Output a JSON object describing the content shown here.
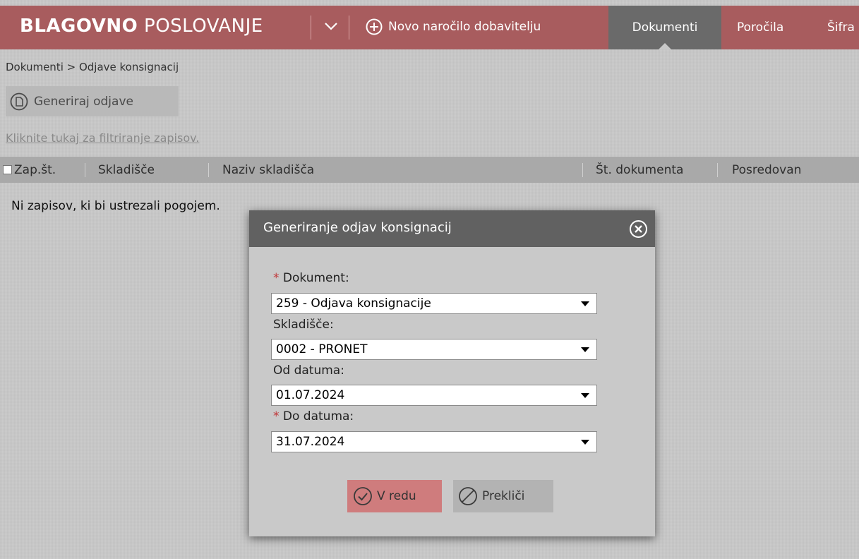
{
  "header": {
    "brand_bold": "BLAGOVNO",
    "brand_light": "POSLOVANJE",
    "new_order_label": "Novo naročilo dobavitelju",
    "nav": [
      "Dokumenti",
      "Poročila",
      "Šifra"
    ],
    "active_nav": "Dokumenti",
    "colors": {
      "bar": "#a85c5e",
      "active": "#6a6a6a"
    }
  },
  "breadcrumb": "Dokumenti > Odjave konsignacij",
  "toolbar": {
    "generate_label": "Generiraj odjave"
  },
  "filter_link": "Kliknite tukaj za filtriranje zapisov.",
  "table": {
    "columns": [
      "Zap.št.",
      "Skladišče",
      "Naziv skladišča",
      "Št. dokumenta",
      "Posredovan"
    ],
    "empty_message": "Ni zapisov, ki bi ustrezali pogojem."
  },
  "dialog": {
    "title": "Generiranje odjav konsignacij",
    "fields": [
      {
        "label": "Dokument:",
        "required": true,
        "value": "259 - Odjava konsignacije"
      },
      {
        "label": "Skladišče:",
        "required": false,
        "value": "0002 - PRONET"
      },
      {
        "label": "Od datuma:",
        "required": false,
        "value": "01.07.2024"
      },
      {
        "label": "Do datuma:",
        "required": true,
        "value": "31.07.2024"
      }
    ],
    "required_mark": "*",
    "ok_label": "V redu",
    "cancel_label": "Prekliči"
  }
}
